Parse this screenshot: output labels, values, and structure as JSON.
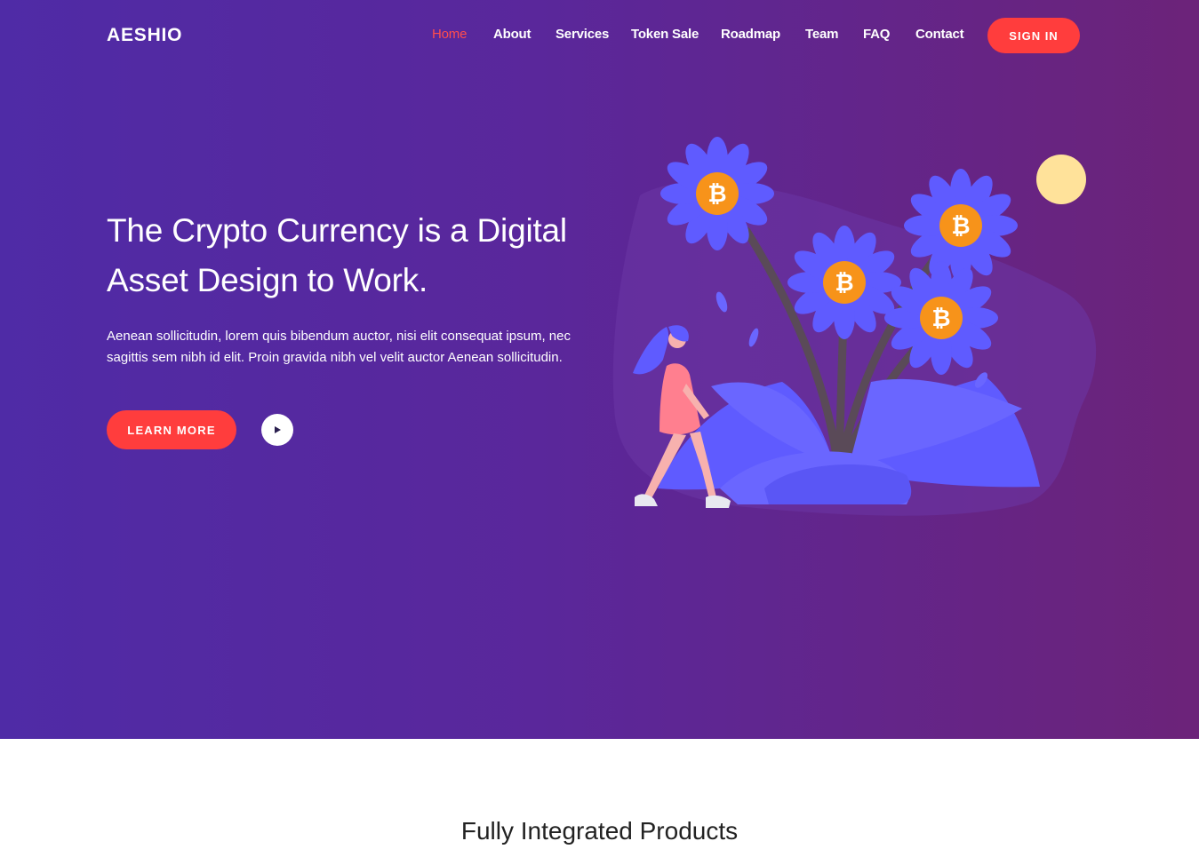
{
  "brand": {
    "logo": "AESHIO"
  },
  "nav": {
    "items": [
      {
        "label": "Home",
        "active": true
      },
      {
        "label": "About"
      },
      {
        "label": "Services"
      },
      {
        "label": "Token Sale"
      },
      {
        "label": "Roadmap"
      },
      {
        "label": "Team"
      },
      {
        "label": "FAQ"
      },
      {
        "label": "Contact"
      }
    ],
    "signin_label": "SIGN IN"
  },
  "hero": {
    "headline_line1": "The Crypto Currency is a Digital",
    "headline_line2": "Asset Design to Work.",
    "sub_line1": "Aenean sollicitudin, lorem quis bibendum auctor, nisi elit consequat ipsum, nec",
    "sub_line2": "sagittis sem nibh id elit. Proin gravida nibh vel velit auctor Aenean sollicitudin.",
    "learn_more_label": "LEARN MORE",
    "play_icon": "play-icon",
    "illustration_icons": [
      "bitcoin-icon",
      "flower",
      "woman-walking",
      "sun"
    ]
  },
  "products": {
    "section_title": "Fully Integrated Products"
  },
  "colors": {
    "accent": "#ff3d3d",
    "hero_gradient_start": "#4f2ba6",
    "hero_gradient_end": "#6c2379",
    "petal": "#5f5bff",
    "coin": "#f7931a",
    "sun": "#ffe29a"
  }
}
